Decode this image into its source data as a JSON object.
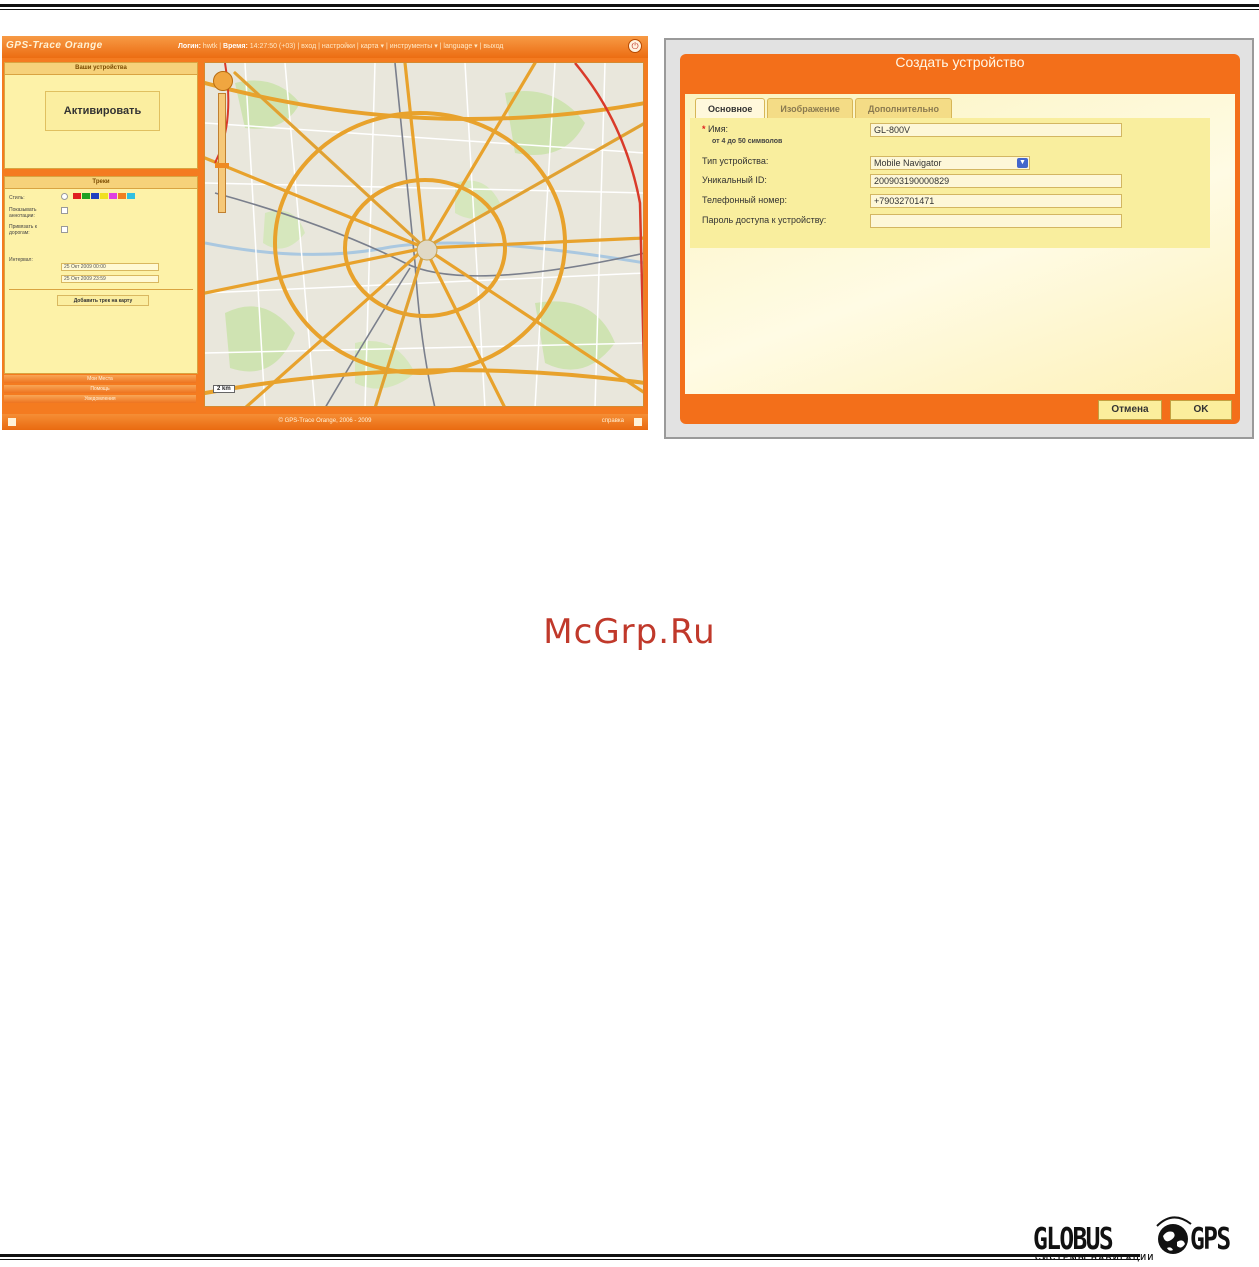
{
  "app": {
    "logo": "GPS-Trace Orange",
    "nav": {
      "user_label": "Логин:",
      "user_value": "hwtk",
      "time_label": "Время:",
      "time_value": "14:27:50 (+03)",
      "links": "| вход | настройки | карта ▾ | инструменты ▾ | language ▾ | выход"
    },
    "devices_panel": {
      "title": "Ваши устройства",
      "activate_label": "Активировать"
    },
    "tracks_panel": {
      "title": "Треки",
      "style_label": "Стиль:",
      "show_annotations_label": "Показывать аннотации:",
      "snap_label": "Привязать к дорогам:",
      "interval_label": "Интервал:",
      "date_from": "25 Окт 2009 00:00",
      "date_to": "25 Окт 2009 23:59",
      "add_track_label": "Добавить трек на карту"
    },
    "collapsed": [
      "Мои Места",
      "Помощь",
      "Уведомления"
    ],
    "map_scale": "2 km",
    "footer_copy": "© GPS-Trace Orange, 2006 - 2009",
    "footer_right": "справка",
    "track_colors": [
      "#e02020",
      "#20a020",
      "#2040c0",
      "#f0e020",
      "#e040e0",
      "#f08020",
      "#30c0e0"
    ]
  },
  "dialog": {
    "title": "Создать устройство",
    "tabs": [
      "Основное",
      "Изображение",
      "Дополнительно"
    ],
    "active_tab": "Основное",
    "fields": {
      "name_label": "Имя:",
      "name_hint": "от 4 до 50 символов",
      "name_value": "GL-800V",
      "type_label": "Тип устройства:",
      "type_value": "Mobile Navigator",
      "uid_label": "Уникальный ID:",
      "uid_value": "200903190000829",
      "phone_label": "Телефонный номер:",
      "phone_value": "+79032701471",
      "password_label": "Пароль доступа к устройству:",
      "password_value": ""
    },
    "cancel_label": "Отмена",
    "ok_label": "OK"
  },
  "watermark": "McGrp.Ru",
  "brand": {
    "left": "GLOBUS",
    "right": "GPS",
    "subtitle": "СИСТЕМЫ НАВИГАЦИИ"
  }
}
